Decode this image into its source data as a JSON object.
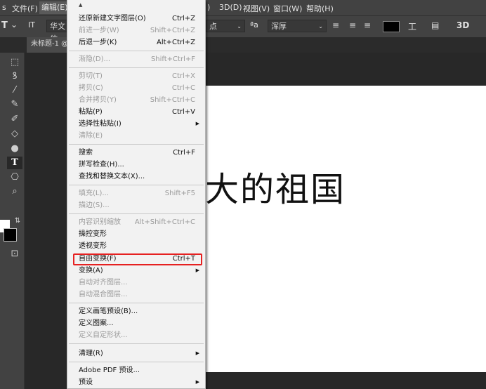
{
  "menubar": {
    "partial_left": "s",
    "file": "文件(F)",
    "edit": "编辑(E)",
    "partial_right": ")",
    "m3d": "3D(D)",
    "view": "视图(V)",
    "window": "窗口(W)",
    "help": "帮助(H)"
  },
  "options": {
    "tool": "T",
    "caret": "⌄",
    "orient": "IT",
    "font_partial": "华文仿",
    "size_partial": "点",
    "aa_label": "ªa",
    "antialias": "浑厚",
    "warp": "工",
    "panel": "▤",
    "three_d": "3D"
  },
  "document": {
    "tab_partial": "未标题-1 @"
  },
  "canvas_text": "大的祖国",
  "menu": {
    "top_arrow": "▲",
    "items": [
      {
        "label": "还原新建文字图层(O)",
        "shortcut": "Ctrl+Z",
        "disabled": false
      },
      {
        "label": "前进一步(W)",
        "shortcut": "Shift+Ctrl+Z",
        "disabled": true
      },
      {
        "label": "后退一步(K)",
        "shortcut": "Alt+Ctrl+Z",
        "disabled": false
      },
      {
        "label": "渐隐(D)...",
        "shortcut": "Shift+Ctrl+F",
        "disabled": true
      },
      {
        "label": "剪切(T)",
        "shortcut": "Ctrl+X",
        "disabled": true
      },
      {
        "label": "拷贝(C)",
        "shortcut": "Ctrl+C",
        "disabled": true
      },
      {
        "label": "合并拷贝(Y)",
        "shortcut": "Shift+Ctrl+C",
        "disabled": true
      },
      {
        "label": "粘贴(P)",
        "shortcut": "Ctrl+V",
        "disabled": false
      },
      {
        "label": "选择性粘贴(I)",
        "shortcut": "",
        "disabled": false,
        "submenu": true
      },
      {
        "label": "清除(E)",
        "shortcut": "",
        "disabled": true
      },
      {
        "label": "搜索",
        "shortcut": "Ctrl+F",
        "disabled": false
      },
      {
        "label": "拼写检查(H)...",
        "shortcut": "",
        "disabled": false
      },
      {
        "label": "查找和替换文本(X)...",
        "shortcut": "",
        "disabled": false
      },
      {
        "label": "填充(L)...",
        "shortcut": "Shift+F5",
        "disabled": true
      },
      {
        "label": "描边(S)...",
        "shortcut": "",
        "disabled": true
      },
      {
        "label": "内容识别缩放",
        "shortcut": "Alt+Shift+Ctrl+C",
        "disabled": true
      },
      {
        "label": "操控变形",
        "shortcut": "",
        "disabled": false
      },
      {
        "label": "透视变形",
        "shortcut": "",
        "disabled": false
      },
      {
        "label": "自由变换(F)",
        "shortcut": "Ctrl+T",
        "disabled": false
      },
      {
        "label": "变换(A)",
        "shortcut": "",
        "disabled": false,
        "submenu": true
      },
      {
        "label": "自动对齐图层...",
        "shortcut": "",
        "disabled": true
      },
      {
        "label": "自动混合图层...",
        "shortcut": "",
        "disabled": true
      },
      {
        "label": "定义画笔预设(B)...",
        "shortcut": "",
        "disabled": false
      },
      {
        "label": "定义图案...",
        "shortcut": "",
        "disabled": false
      },
      {
        "label": "定义自定形状...",
        "shortcut": "",
        "disabled": true
      },
      {
        "label": "清理(R)",
        "shortcut": "",
        "disabled": false,
        "submenu": true
      },
      {
        "label": "Adobe PDF 预设...",
        "shortcut": "",
        "disabled": false
      },
      {
        "label": "预设",
        "shortcut": "",
        "disabled": false,
        "submenu": true
      }
    ]
  },
  "tools": [
    "⬚",
    "ꝸ",
    "⁄",
    "✎",
    "✐",
    "◇",
    "●",
    "T",
    "⎔",
    "⌕"
  ],
  "colors": {
    "foreground": "#000000",
    "background": "#ffffff",
    "highlight": "#e62121"
  }
}
